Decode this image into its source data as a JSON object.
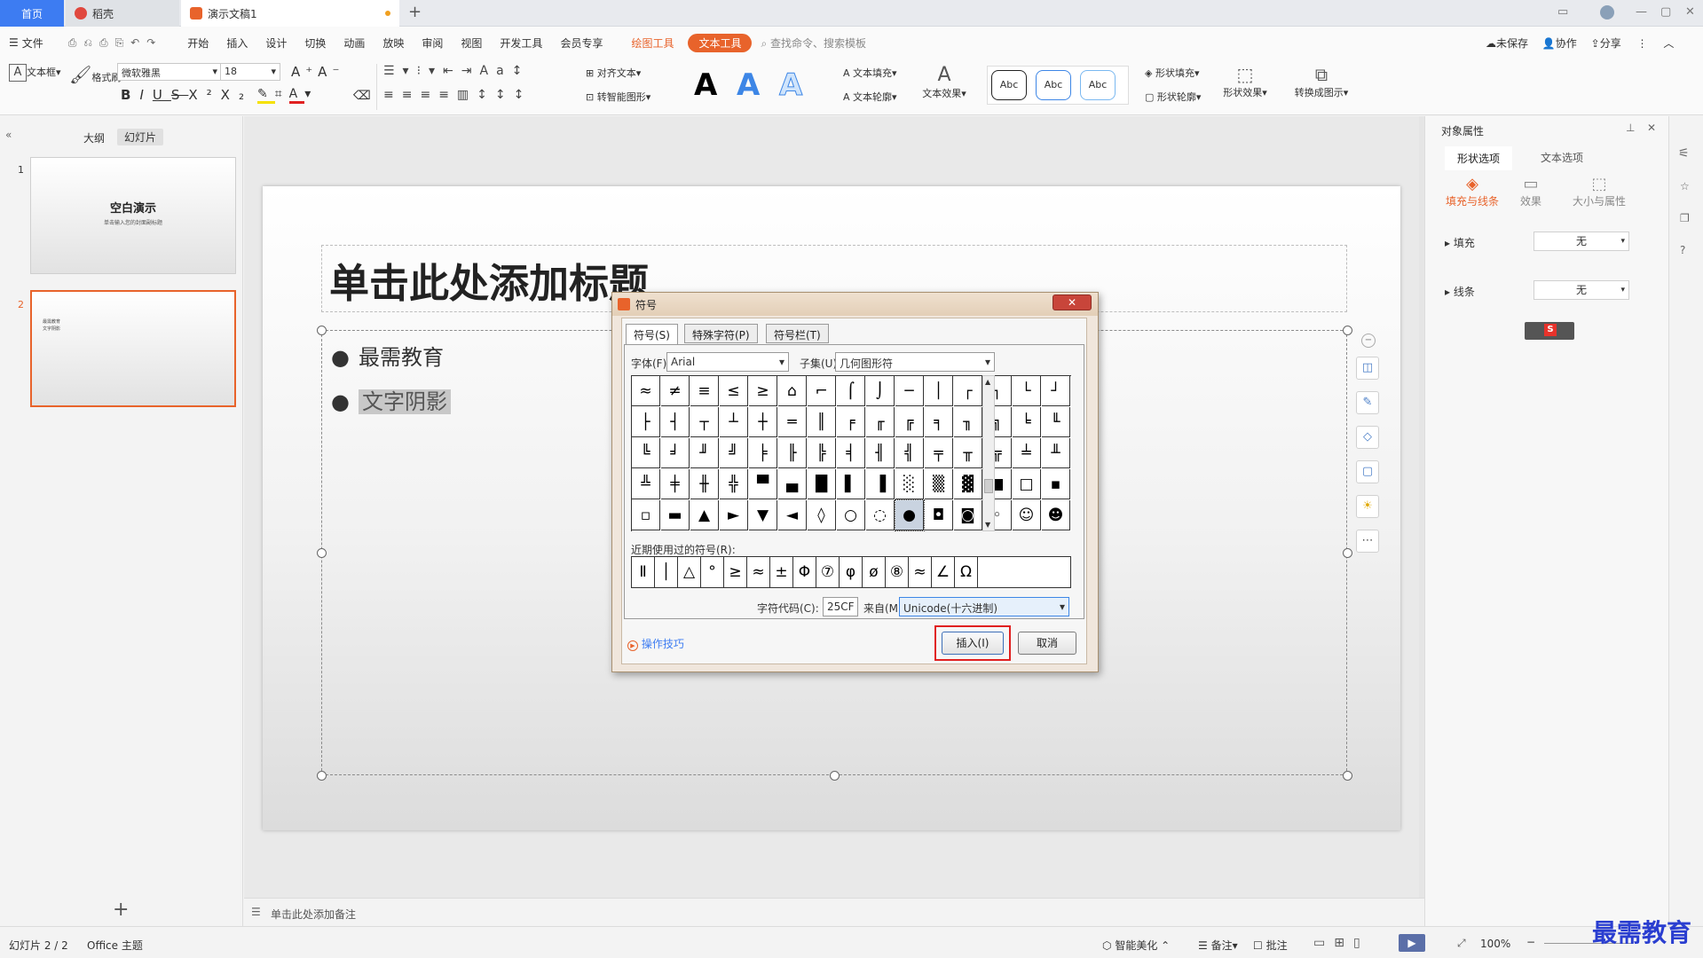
{
  "tabs": {
    "home": "首页",
    "daoke": "稻壳",
    "doc": "演示文稿1",
    "add": "+"
  },
  "menu": {
    "file": "文件",
    "items": [
      "开始",
      "插入",
      "设计",
      "切换",
      "动画",
      "放映",
      "审阅",
      "视图",
      "开发工具",
      "会员专享"
    ],
    "drawing_tools": "绘图工具",
    "text_tools": "文本工具",
    "search": "查找命令、搜索模板",
    "unsaved": "未保存",
    "collab": "协作",
    "share": "分享"
  },
  "ribbon": {
    "textbox": "文本框",
    "format_painter": "格式刷",
    "font_name": "微软雅黑",
    "font_size": "18",
    "align_text": "对齐文本",
    "smart_graphic": "转智能图形",
    "text_fill": "文本填充",
    "text_outline": "文本轮廓",
    "text_effect": "文本效果",
    "style_abc": "Abc",
    "shape_fill": "形状填充",
    "shape_outline": "形状轮廓",
    "shape_effect": "形状效果",
    "convert": "转换成图示",
    "big_a": "A"
  },
  "leftpanel": {
    "tab_outline": "大纲",
    "tab_slides": "幻灯片",
    "slide1_num": "1",
    "slide1_title": "空白演示",
    "slide1_sub": "单击输入您的封面副标题",
    "slide2_num": "2",
    "slide2_line1": "最需教育",
    "slide2_line2": "文字阴影",
    "add": "+"
  },
  "slide": {
    "title": "单击此处添加标题",
    "bullet1": "最需教育",
    "bullet2": "文字阴影"
  },
  "notes": "单击此处添加备注",
  "rightpanel": {
    "title": "对象属性",
    "tab_shape": "形状选项",
    "tab_text": "文本选项",
    "sub_fill_line": "填充与线条",
    "sub_effect": "效果",
    "sub_size": "大小与属性",
    "fill_label": "填充",
    "fill_value": "无",
    "line_label": "线条",
    "line_value": "无"
  },
  "dialog": {
    "title": "符号",
    "tabs": [
      "符号(S)",
      "特殊字符(P)",
      "符号栏(T)"
    ],
    "font_label": "字体(F):",
    "font_value": "Arial",
    "subset_label": "子集(U):",
    "subset_value": "几何图形符",
    "grid": [
      [
        "≈",
        "≠",
        "≡",
        "≤",
        "≥",
        "⌂",
        "⌐",
        "⌠",
        "⌡",
        "─",
        "│",
        "┌",
        "┐",
        "└",
        "┘"
      ],
      [
        "├",
        "┤",
        "┬",
        "┴",
        "┼",
        "═",
        "║",
        "╒",
        "╓",
        "╔",
        "╕",
        "╖",
        "╗",
        "╘",
        "╙"
      ],
      [
        "╚",
        "╛",
        "╜",
        "╝",
        "╞",
        "╟",
        "╠",
        "╡",
        "╢",
        "╣",
        "╤",
        "╥",
        "╦",
        "╧",
        "╨"
      ],
      [
        "╩",
        "╪",
        "╫",
        "╬",
        "▀",
        "▄",
        "█",
        "▌",
        "▐",
        "░",
        "▒",
        "▓",
        "■",
        "□",
        "▪"
      ],
      [
        "▫",
        "▬",
        "▲",
        "►",
        "▼",
        "◄",
        "◊",
        "○",
        "◌",
        "●",
        "◘",
        "◙",
        "◦",
        "☺",
        "☻"
      ]
    ],
    "recent_label": "近期使用过的符号(R):",
    "recent": [
      "Ⅱ",
      "│",
      "△",
      "°",
      "≥",
      "≈",
      "±",
      "Φ",
      "⑦",
      "φ",
      "ø",
      "⑧",
      "≈",
      "∠",
      "Ω"
    ],
    "code_label": "字符代码(C):",
    "code_value": "25CF",
    "from_label": "来自(M)",
    "from_value": "Unicode(十六进制)",
    "tips": "操作技巧",
    "insert": "插入(I)",
    "cancel": "取消"
  },
  "status": {
    "slide_count": "幻灯片 2 / 2",
    "theme": "Office 主题",
    "beautify": "智能美化",
    "notes": "备注",
    "comments": "批注",
    "zoom": "100%"
  },
  "watermark": "最需教育"
}
